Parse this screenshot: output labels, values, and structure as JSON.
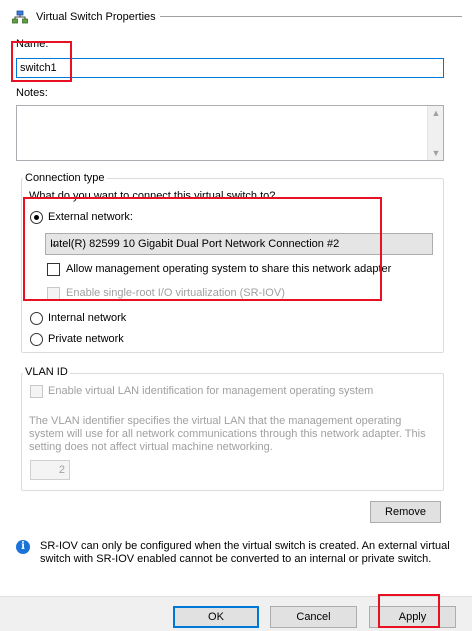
{
  "header": {
    "title": "Virtual Switch Properties",
    "icon": "network-switch-icon"
  },
  "name": {
    "label": "Name:",
    "value": "switch1"
  },
  "notes": {
    "label": "Notes:",
    "value": ""
  },
  "connection": {
    "group_title": "Connection type",
    "question": "What do you want to connect this virtual switch to?",
    "external_label": "External network:",
    "external_checked": true,
    "adapter_selected": "Intel(R) 82599 10 Gigabit Dual Port Network Connection #2",
    "allow_mgmt_label": "Allow management operating system to share this network adapter",
    "allow_mgmt_checked": false,
    "sriov_label": "Enable single-root I/O virtualization (SR-IOV)",
    "sriov_enabled": false,
    "internal_label": "Internal network",
    "private_label": "Private network"
  },
  "vlan": {
    "group_title": "VLAN ID",
    "enable_label": "Enable virtual LAN identification for management operating system",
    "description": "The VLAN identifier specifies the virtual LAN that the management operating system will use for all network communications through this network adapter. This setting does not affect virtual machine networking.",
    "value": "2"
  },
  "remove_label": "Remove",
  "info": {
    "icon": "info-icon",
    "text": "SR-IOV can only be configured when the virtual switch is created. An external virtual switch with SR-IOV enabled cannot be converted to an internal or private switch."
  },
  "footer": {
    "ok_label": "OK",
    "cancel_label": "Cancel",
    "apply_label": "Apply"
  },
  "colors": {
    "highlight_box": "#e81123",
    "accent": "#0078d7",
    "info_icon": "#1a73d9"
  }
}
